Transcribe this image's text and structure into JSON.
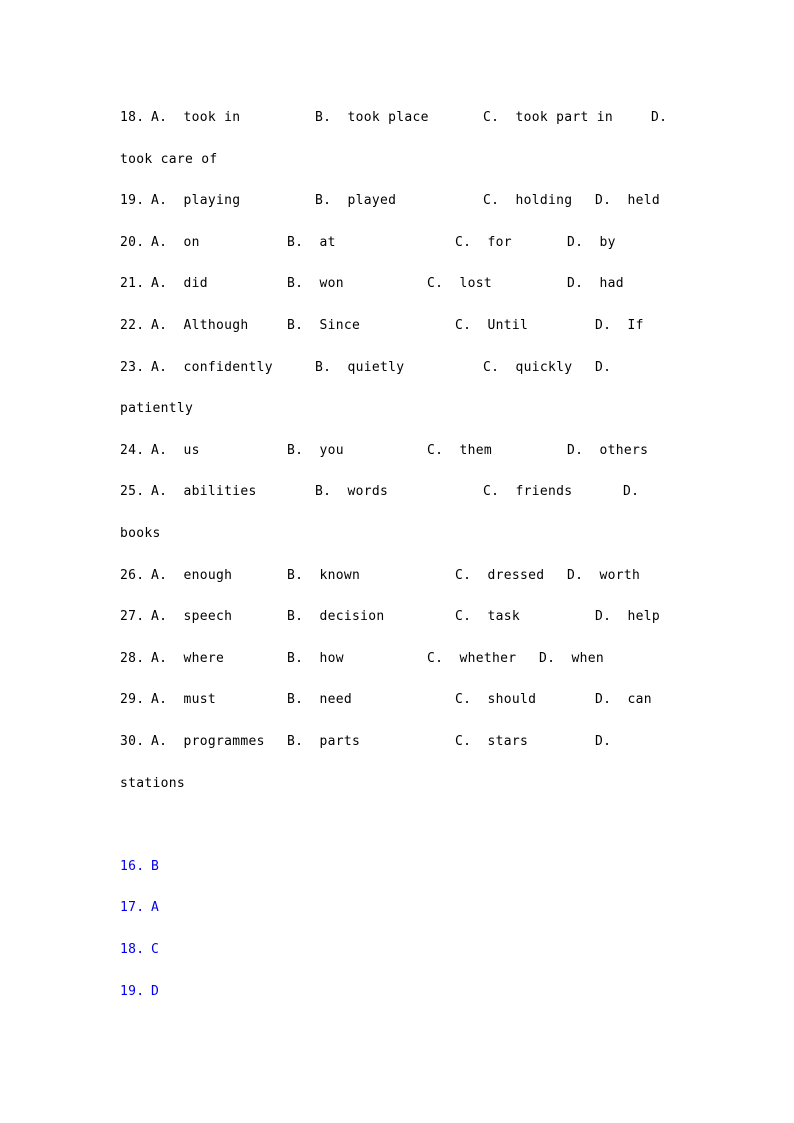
{
  "questions": [
    {
      "num": "18.",
      "a": "A.  took in",
      "b": "B.  took place",
      "c": "C.  took part in",
      "d": "D.",
      "wrap": "took care of"
    },
    {
      "num": "19.",
      "a": "A.  playing",
      "b": "B.  played",
      "c": "C.  holding",
      "d": "D.  held"
    },
    {
      "num": "20.",
      "a": "A.  on",
      "b": "B.  at",
      "c": "C.  for",
      "d": "D.  by"
    },
    {
      "num": "21.",
      "a": "A.  did",
      "b": "B.  won",
      "c": "C.  lost",
      "d": "D.  had"
    },
    {
      "num": "22.",
      "a": "A.  Although",
      "b": "B.  Since",
      "c": "C.  Until",
      "d": "D.  If"
    },
    {
      "num": "23.",
      "a": "A.  confidently",
      "b": "B.  quietly",
      "c": "C.  quickly",
      "d": "D.",
      "wrap": "patiently"
    },
    {
      "num": "24.",
      "a": "A.  us",
      "b": "B.  you",
      "c": "C.  them",
      "d": "D.  others"
    },
    {
      "num": "25.",
      "a": "A.  abilities",
      "b": "B.  words",
      "c": "C.  friends",
      "d": "D.",
      "wrap": "books"
    },
    {
      "num": "26.",
      "a": "A.  enough",
      "b": "B.  known",
      "c": "C.  dressed",
      "d": "D.  worth"
    },
    {
      "num": "27.",
      "a": "A.  speech",
      "b": "B.  decision",
      "c": "C.  task",
      "d": "D.  help"
    },
    {
      "num": "28.",
      "a": "A.  where",
      "b": "B.  how",
      "c": "C.  whether",
      "d": "D.  when"
    },
    {
      "num": "29.",
      "a": "A.  must",
      "b": "B.  need",
      "c": "C.  should",
      "d": "D.  can"
    },
    {
      "num": "30.",
      "a": "A.  programmes",
      "b": "B.  parts",
      "c": "C.  stars",
      "d": "D.",
      "wrap": "stations"
    }
  ],
  "answers": [
    {
      "num": "16.",
      "letter": "B"
    },
    {
      "num": "17.",
      "letter": "A"
    },
    {
      "num": "18.",
      "letter": "C"
    },
    {
      "num": "19.",
      "letter": "D"
    }
  ],
  "colors": {
    "text": "#000000",
    "answer": "#0000ee"
  }
}
